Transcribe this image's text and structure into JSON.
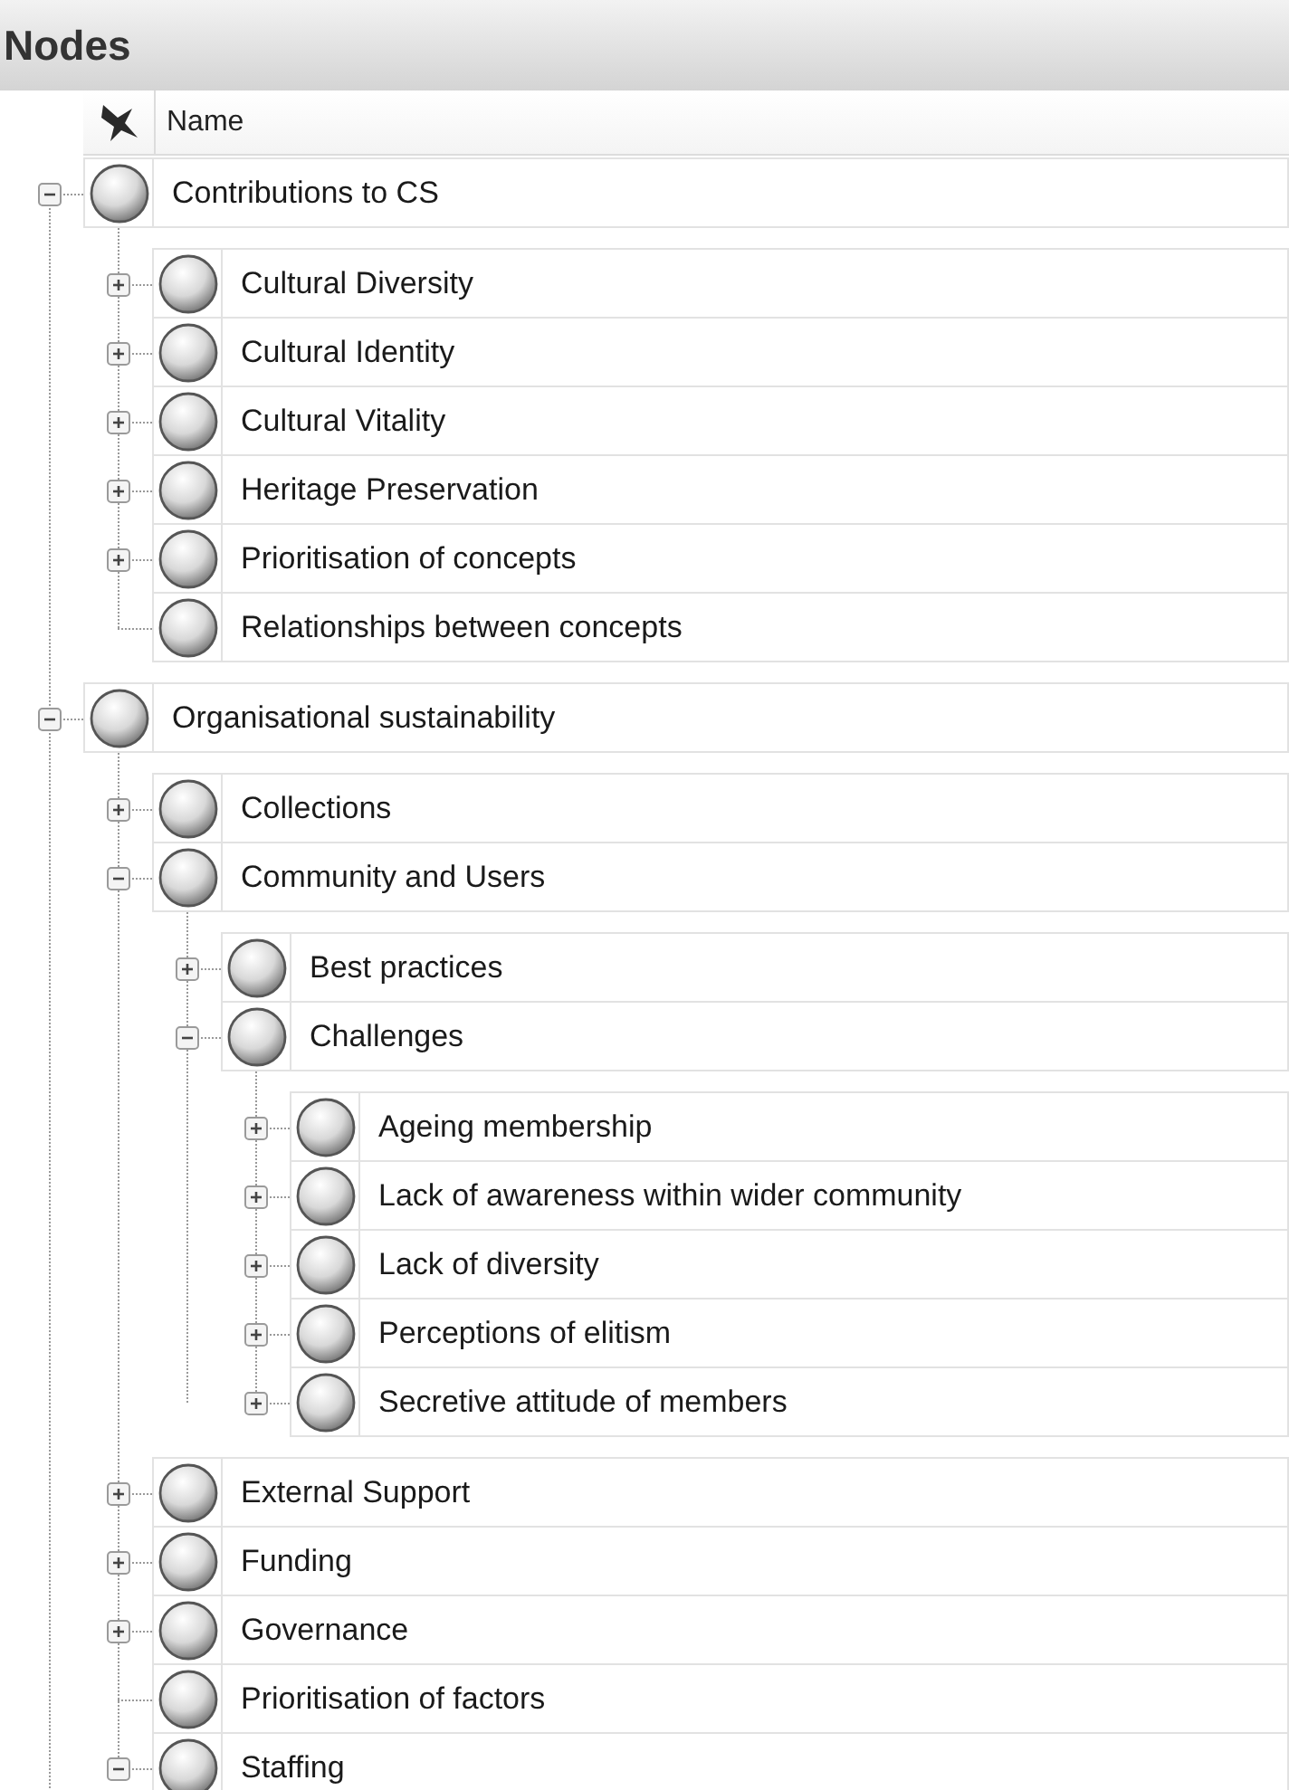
{
  "panel": {
    "title": "Nodes"
  },
  "table": {
    "columns": [
      "Name"
    ],
    "nodes": [
      {
        "name": "Contributions to CS",
        "kind": "branch",
        "expanded": true,
        "children": [
          {
            "name": "Cultural Diversity",
            "kind": "branch",
            "expanded": false
          },
          {
            "name": "Cultural Identity",
            "kind": "branch",
            "expanded": false
          },
          {
            "name": "Cultural Vitality",
            "kind": "branch",
            "expanded": false
          },
          {
            "name": "Heritage Preservation",
            "kind": "branch",
            "expanded": false
          },
          {
            "name": "Prioritisation of concepts",
            "kind": "branch",
            "expanded": false
          },
          {
            "name": "Relationships between concepts",
            "kind": "leaf"
          }
        ]
      },
      {
        "name": "Organisational sustainability",
        "kind": "branch",
        "expanded": true,
        "children": [
          {
            "name": "Collections",
            "kind": "branch",
            "expanded": false
          },
          {
            "name": "Community and Users",
            "kind": "branch",
            "expanded": true,
            "children": [
              {
                "name": "Best practices",
                "kind": "branch",
                "expanded": false
              },
              {
                "name": "Challenges",
                "kind": "branch",
                "expanded": true,
                "children": [
                  {
                    "name": "Ageing membership",
                    "kind": "branch",
                    "expanded": false
                  },
                  {
                    "name": "Lack of awareness within wider community",
                    "kind": "branch",
                    "expanded": false
                  },
                  {
                    "name": "Lack of diversity",
                    "kind": "branch",
                    "expanded": false
                  },
                  {
                    "name": "Perceptions of elitism",
                    "kind": "branch",
                    "expanded": false
                  },
                  {
                    "name": "Secretive attitude of members",
                    "kind": "branch",
                    "expanded": false
                  }
                ]
              }
            ]
          },
          {
            "name": "External Support",
            "kind": "branch",
            "expanded": false
          },
          {
            "name": "Funding",
            "kind": "branch",
            "expanded": false
          },
          {
            "name": "Governance",
            "kind": "branch",
            "expanded": false
          },
          {
            "name": "Prioritisation of factors",
            "kind": "leaf"
          },
          {
            "name": "Staffing",
            "kind": "branch",
            "expanded": true
          }
        ]
      }
    ]
  }
}
